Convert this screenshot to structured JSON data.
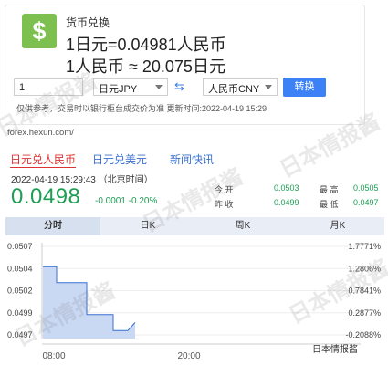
{
  "converter": {
    "icon": "dollar-icon",
    "title": "货币兑换",
    "rate_line_1": "1日元=0.04981人民币",
    "rate_line_2": "1人民币 ≈ 20.075日元",
    "amount_value": "1",
    "from_currency": "日元JPY",
    "to_currency": "人民币CNY",
    "swap_icon": "swap-icon",
    "convert_label": "转换",
    "disclaimer": "仅供参考，交易时以银行柜台成交价为准 更新时间:2022-04-19 15:29"
  },
  "source": "forex.hexun.com/",
  "quote": {
    "tabs": [
      "日元兑人民币",
      "日元兑美元",
      "新闻快讯"
    ],
    "timestamp": "2022-04-19 15:29:43 （北京时间）",
    "price": "0.0498",
    "change": "-0.0001 -0.20%",
    "open_label": "今 开",
    "open_value": "0.0503",
    "high_label": "最 高",
    "high_value": "0.0505",
    "prev_label": "昨 收",
    "prev_value": "0.0499",
    "low_label": "最 低",
    "low_value": "0.0497"
  },
  "period_tabs": [
    "分时",
    "日K",
    "周K",
    "月K"
  ],
  "chart_data": {
    "type": "line",
    "x_ticks": [
      "08:00",
      "20:00"
    ],
    "y_ticks_left": [
      "0.0507",
      "0.0504",
      "0.0502",
      "0.0499",
      "0.0497"
    ],
    "y_ticks_right": [
      "1.7771%",
      "1.2806%",
      "0.7841%",
      "0.2877%",
      "-0.2088%"
    ],
    "series": [
      {
        "values": [
          0.0505,
          0.0505,
          0.0503,
          0.0503,
          0.0499,
          0.0499,
          0.0497,
          0.0497,
          0.0498
        ]
      }
    ],
    "ylim": [
      0.0496,
      0.0508
    ],
    "line_color": "#3a6fd0",
    "fill_color": "#c9d8f3"
  },
  "watermark_text": "日本情报酱",
  "footer_mark": "日本情报酱"
}
